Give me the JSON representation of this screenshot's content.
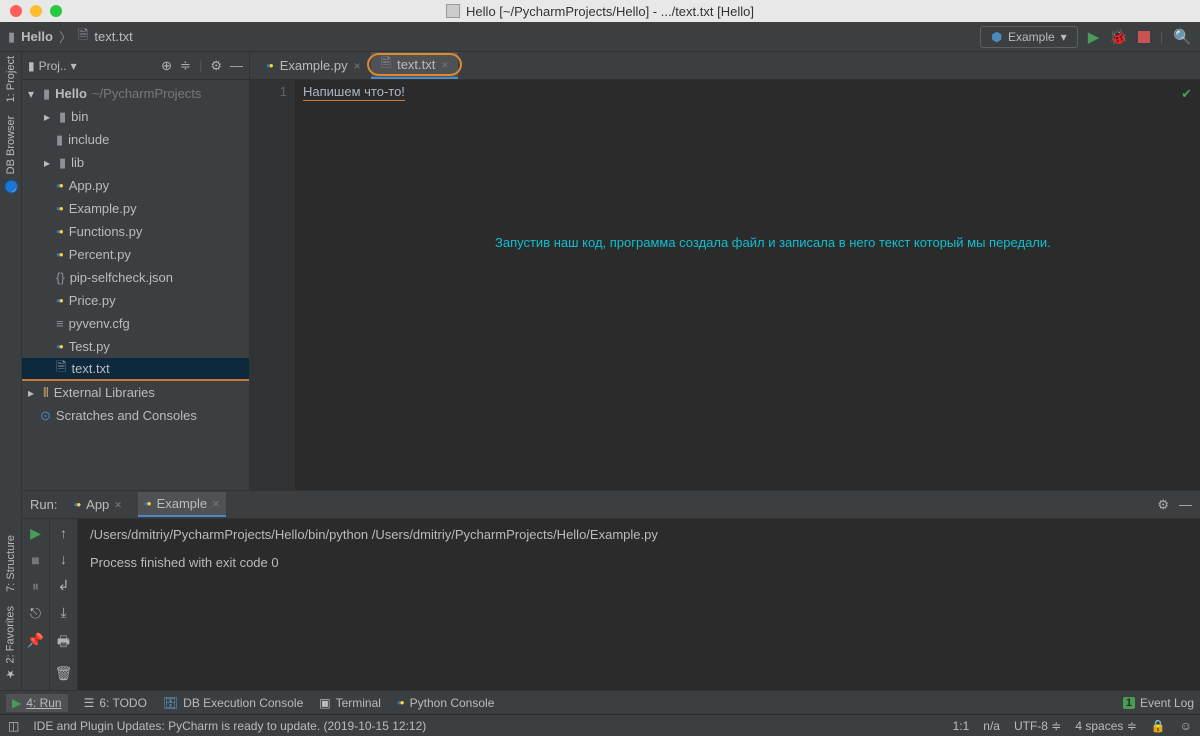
{
  "titlebar": {
    "title": "Hello [~/PycharmProjects/Hello] - .../text.txt [Hello]"
  },
  "breadcrumb": {
    "project": "Hello",
    "file": "text.txt"
  },
  "toolbar_right": {
    "config": "Example"
  },
  "left_rails": {
    "project": "1: Project",
    "db": "DB Browser",
    "structure": "7: Structure",
    "favorites": "2: Favorites"
  },
  "project_panel": {
    "title": "Proj..",
    "root": {
      "name": "Hello",
      "path": "~/PycharmProjects"
    },
    "dirs": [
      "bin",
      "include",
      "lib"
    ],
    "files": [
      "App.py",
      "Example.py",
      "Functions.py",
      "Percent.py",
      "pip-selfcheck.json",
      "Price.py",
      "pyvenv.cfg",
      "Test.py",
      "text.txt"
    ],
    "external": "External Libraries",
    "scratches": "Scratches and Consoles"
  },
  "tabs": {
    "t1": "Example.py",
    "t2": "text.txt"
  },
  "editor": {
    "gutter_line": "1",
    "line1": "Напишем что-то!"
  },
  "annotation": "Запустив наш код, программа создала файл и записала в него текст который мы передали.",
  "run_panel": {
    "label": "Run:",
    "tabs": {
      "t1": "App",
      "t2": "Example"
    },
    "line1": "/Users/dmitriy/PycharmProjects/Hello/bin/python /Users/dmitriy/PycharmProjects/Hello/Example.py",
    "line2": "Process finished with exit code 0"
  },
  "bottom_tools": {
    "run": "4: Run",
    "todo": "6: TODO",
    "db": "DB Execution Console",
    "terminal": "Terminal",
    "python": "Python Console",
    "event_log": "Event Log",
    "event_badge": "1"
  },
  "status_bar": {
    "msg": "IDE and Plugin Updates: PyCharm is ready to update. (2019-10-15 12:12)",
    "pos": "1:1",
    "br": "n/a",
    "enc": "UTF-8",
    "indent": "4 spaces"
  }
}
